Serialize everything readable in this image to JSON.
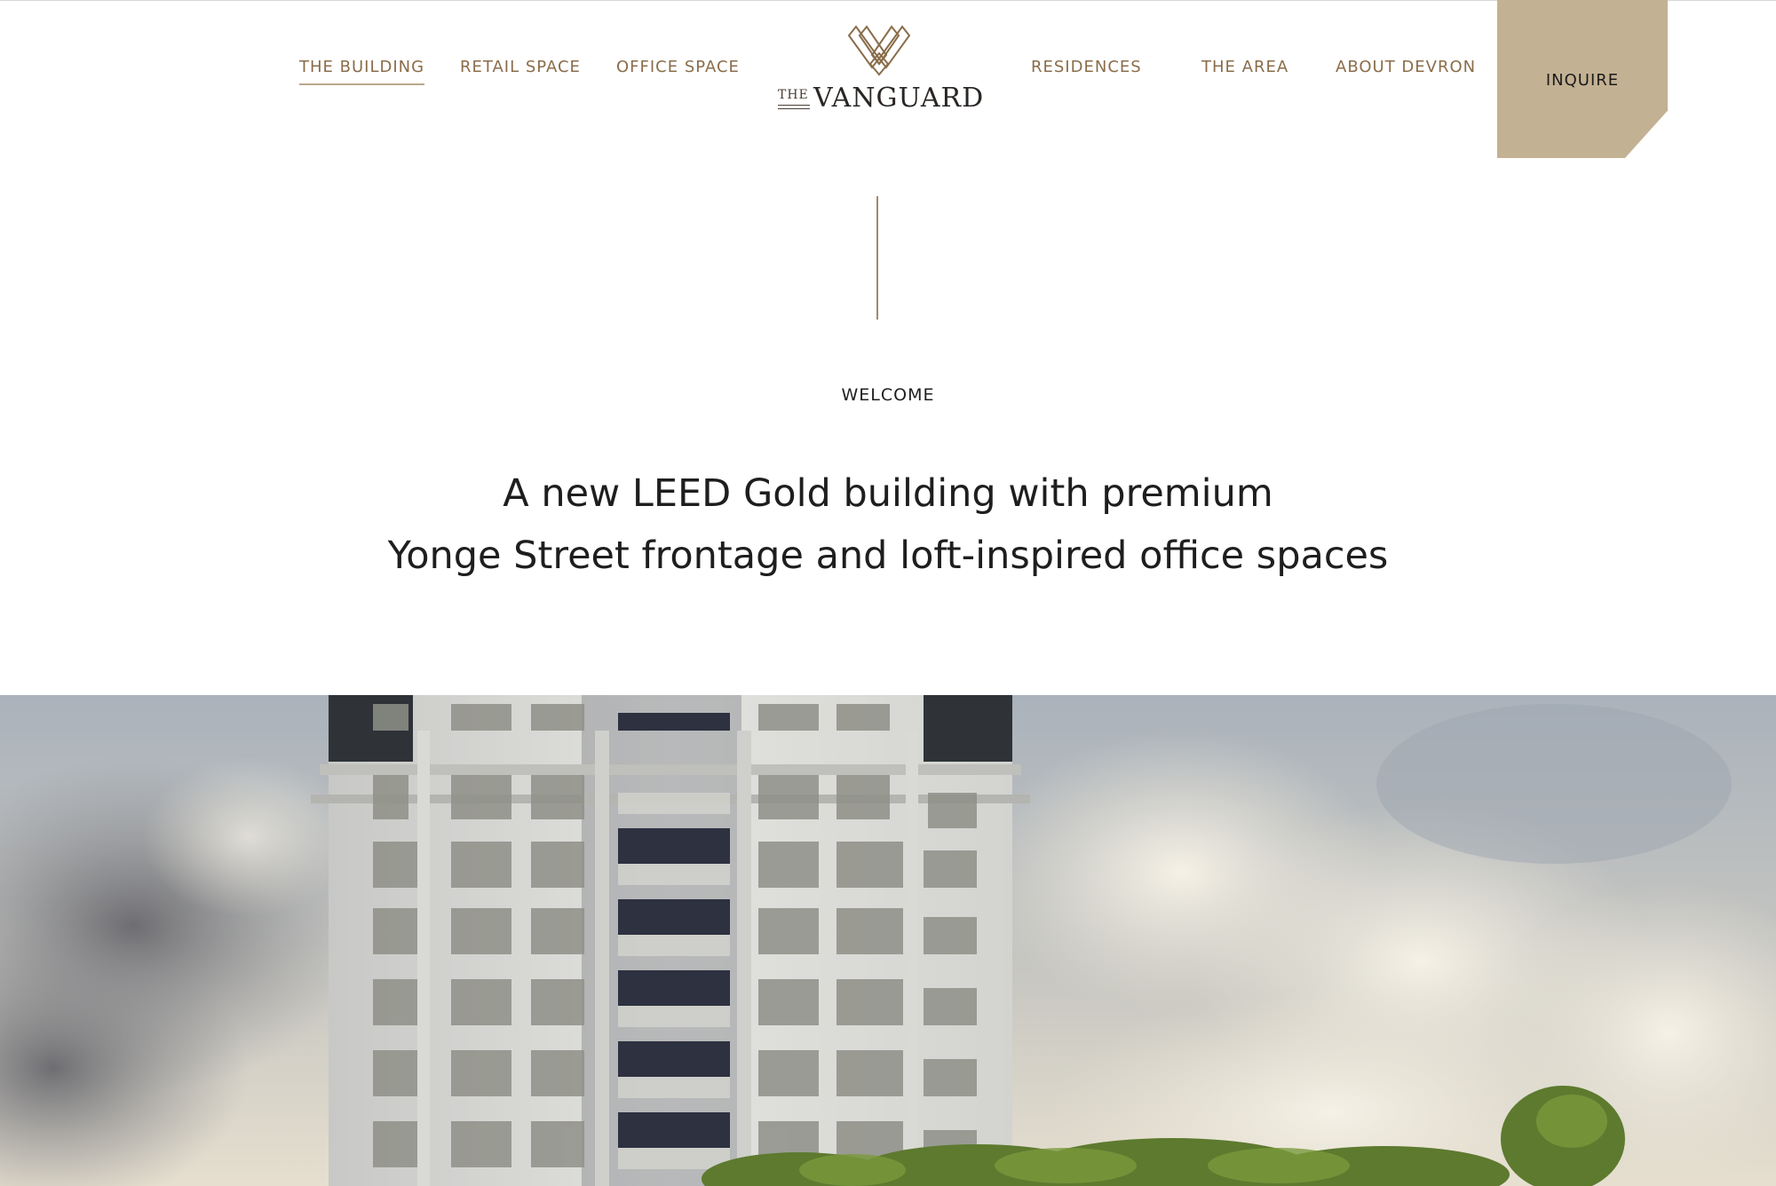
{
  "nav": {
    "left": [
      {
        "label": "THE BUILDING"
      },
      {
        "label": "RETAIL SPACE"
      },
      {
        "label": "OFFICE SPACE"
      }
    ],
    "right": [
      {
        "label": "RESIDENCES"
      },
      {
        "label": "THE AREA"
      },
      {
        "label": "ABOUT DEVRON"
      }
    ],
    "active": "THE BUILDING",
    "cta": "INQUIRE"
  },
  "logo": {
    "prefix": "THE",
    "name": "VANGUARD"
  },
  "intro": {
    "eyebrow": "WELCOME",
    "headline_line1": "A new LEED Gold building with premium",
    "headline_line2": "Yonge Street frontage and loft-inspired office spaces"
  },
  "colors": {
    "accent": "#8a6d4a",
    "cta_background": "#c3b193",
    "text": "#1e1e1e"
  },
  "icons": {
    "logo_mark": "interlocking-chevron-logo-icon"
  }
}
